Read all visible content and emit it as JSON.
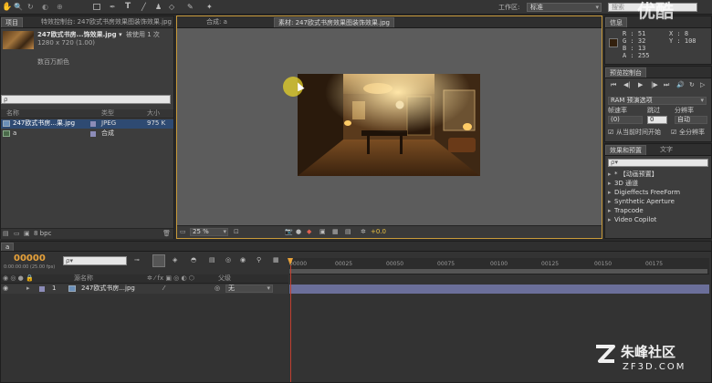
{
  "menubar": {
    "workspace_label": "工作区:",
    "workspace_value": "标准",
    "search_placeholder": "搜索"
  },
  "project_panel": {
    "tab_label": "项目",
    "effect_controls_tab": "特效控制台: 247欧式书房效果图装饰效果.jpg",
    "file_name": "247欧式书房...饰效果.jpg ▾",
    "used_count": "被使用 1 次",
    "dimensions": "1280 x 720 (1.00)",
    "color_info": "数百万颜色",
    "columns": {
      "name": "名称",
      "type": "类型",
      "size": "大小"
    },
    "items": [
      {
        "name": "247欧式书房...果.jpg",
        "type": "JPEG",
        "size": "975 K",
        "swatch": "#8c8cb8"
      },
      {
        "name": "a",
        "type": "合成",
        "size": "",
        "swatch": "#8c8cb8"
      }
    ],
    "bpc": "8 bpc"
  },
  "viewer": {
    "comp_tab": "合成: a",
    "footage_tab": "素材: 247欧式书房效果图装饰效果.jpg",
    "zoom": "25 %",
    "offset": "+0.0"
  },
  "info_panel": {
    "tab": "信息",
    "r": "R : 51",
    "g": "G : 32",
    "b": "B : 13",
    "a": "A : 255",
    "x": "X : 8",
    "y": "Y : 108",
    "swatch_color": "#33200d"
  },
  "preview_panel": {
    "tab": "预览控制台",
    "ram_preview": "RAM 预演选项",
    "frame_rate_label": "帧速率",
    "skip_label": "跳过",
    "resolution_label": "分辨率",
    "frame_rate_value": "(0)",
    "skip_value": "0",
    "resolution_value": "自动",
    "from_current": "从当前时间开始",
    "full_screen": "全分辨率"
  },
  "effects_panel": {
    "tab": "效果和预置",
    "text_tab": "文字",
    "search_placeholder": "ρ▾",
    "items": [
      "* 【动画预置】",
      "3D 通道",
      "Digieffects FreeForm",
      "Synthetic Aperture",
      "Trapcode",
      "Video Copilot"
    ]
  },
  "timeline": {
    "tab": "a",
    "timecode": "00000",
    "timecode_sub": "0:00:00:00 (25.00 fps)",
    "search_placeholder": "ρ▾",
    "columns": {
      "source_name": "源名称",
      "parent": "父级"
    },
    "layer": {
      "index": "1",
      "name": "247欧式书房...jpg",
      "parent": "无"
    },
    "ruler_ticks": [
      "00000",
      "00025",
      "00050",
      "00075",
      "00100",
      "00125",
      "00150",
      "00175"
    ]
  },
  "watermarks": {
    "youku": "优酷",
    "zf3d_name": "朱峰社区",
    "zf3d_url": "ZF3D.COM"
  }
}
